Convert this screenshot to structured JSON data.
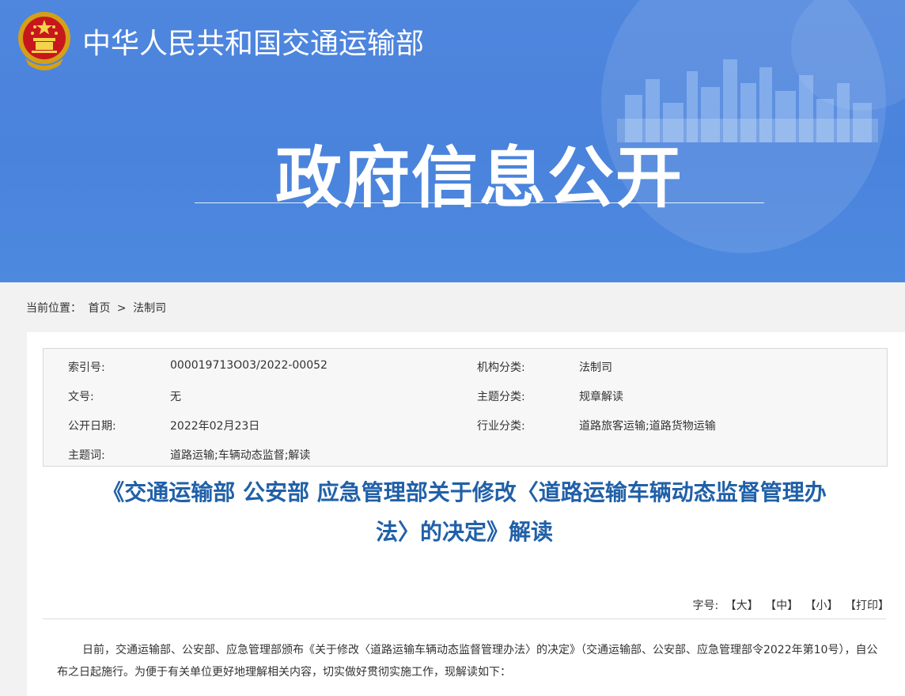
{
  "header": {
    "ministry_name": "中华人民共和国交通运输部",
    "banner_title": "政府信息公开"
  },
  "breadcrumb": {
    "label": "当前位置：",
    "home": "首页",
    "separator": ">",
    "current": "法制司"
  },
  "meta": {
    "index_no_label": "索引号:",
    "index_no": "000019713O03/2022-00052",
    "org_label": "机构分类:",
    "org": "法制司",
    "doc_no_label": "文号:",
    "doc_no": "无",
    "topic_label": "主题分类:",
    "topic": "规章解读",
    "date_label": "公开日期:",
    "date": "2022年02月23日",
    "industry_label": "行业分类:",
    "industry": "道路旅客运输;道路货物运输",
    "keywords_label": "主题词:",
    "keywords": "道路运输;车辆动态监督;解读"
  },
  "article": {
    "title_line1": "《交通运输部 公安部 应急管理部关于修改〈道路运输车辆动态监督管理办",
    "title_line2": "法〉的决定》解读",
    "paragraph": "日前，交通运输部、公安部、应急管理部颁布《关于修改〈道路运输车辆动态监督管理办法〉的决定》（交通运输部、公安部、应急管理部令2022年第10号），自公布之日起施行。为便于有关单位更好地理解相关内容，切实做好贯彻实施工作，现解读如下："
  },
  "font_controls": {
    "label": "字号:",
    "large": "【大】",
    "medium": "【中】",
    "small": "【小】",
    "print": "【打印】"
  },
  "colors": {
    "banner": "#4a83dc",
    "title": "#2060a8"
  }
}
